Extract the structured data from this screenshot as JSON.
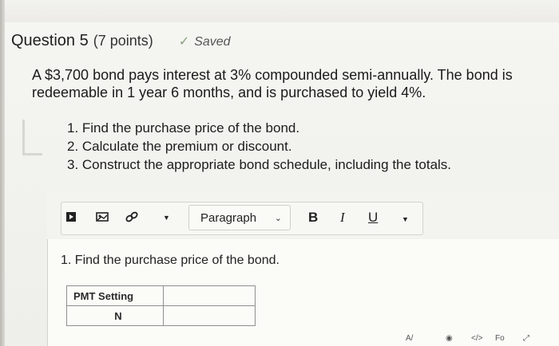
{
  "question": {
    "title": "Question 5",
    "points": "(7 points)",
    "status": "Saved",
    "prompt": "A $3,700 bond pays interest at 3% compounded semi-annually. The bond is redeemable in 1 year 6 months, and is purchased to yield 4%.",
    "steps": [
      "1. Find the purchase price of the bond.",
      "2. Calculate the premium or discount.",
      "3. Construct the appropriate bond schedule, including the totals."
    ]
  },
  "toolbar": {
    "paragraph_select": "Paragraph",
    "bold": "B",
    "italic": "I",
    "underline": "U",
    "icons": [
      "media-icon",
      "image-icon",
      "link-icon",
      "more-insert-dropdown-icon",
      "text-color-dropdown-icon"
    ]
  },
  "editor": {
    "text": "1. Find the purchase price of the bond.",
    "table": {
      "rows": [
        [
          "PMT Setting",
          ""
        ],
        [
          "N",
          ""
        ]
      ]
    }
  },
  "status_bar": {
    "icons": [
      "accessibility-icon",
      "view-icon",
      "html-editor-icon",
      "font-icon",
      "fullscreen-icon"
    ]
  }
}
